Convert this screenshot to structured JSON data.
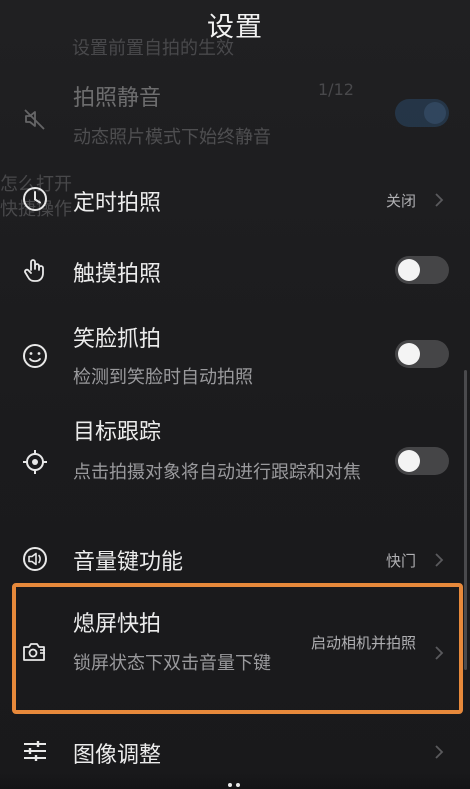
{
  "header": {
    "title": "设置"
  },
  "background_ghost_text": {
    "top_partial": "设置前置自拍的生效",
    "left_1": "怎么打开",
    "left_2": "快捷操作",
    "right_partial": "1/12"
  },
  "items": [
    {
      "id": "photo-mute",
      "icon": "mute-speaker-icon",
      "title": "拍照静音",
      "subtitle": "动态照片模式下始终静音",
      "control": "toggle",
      "toggle_on": true,
      "disabled": true
    },
    {
      "id": "timer-photo",
      "icon": "clock-icon",
      "title": "定时拍照",
      "value": "关闭",
      "control": "chevron"
    },
    {
      "id": "touch-photo",
      "icon": "touch-hand-icon",
      "title": "触摸拍照",
      "control": "toggle",
      "toggle_on": false
    },
    {
      "id": "smile-capture",
      "icon": "smile-face-icon",
      "title": "笑脸抓拍",
      "subtitle": "检测到笑脸时自动拍照",
      "control": "toggle",
      "toggle_on": false
    },
    {
      "id": "target-tracking",
      "icon": "target-crosshair-icon",
      "title": "目标跟踪",
      "subtitle": "点击拍摄对象将自动进行跟踪和对焦",
      "control": "toggle",
      "toggle_on": false
    },
    {
      "id": "volume-key",
      "icon": "volume-speaker-icon",
      "title": "音量键功能",
      "value": "快门",
      "control": "chevron"
    },
    {
      "id": "screen-off-snapshot",
      "icon": "camera-snap-icon",
      "title": "熄屏快拍",
      "subtitle": "锁屏状态下双击音量下键",
      "value": "启动相机并拍照",
      "control": "chevron",
      "highlighted": true
    },
    {
      "id": "image-adjust",
      "icon": "sliders-icon",
      "title": "图像调整",
      "control": "chevron"
    }
  ],
  "colors": {
    "background": "#1d1d1f",
    "highlight_border": "#e7893b",
    "toggle_off_track": "#454547",
    "toggle_on_track": "#2f5b85"
  }
}
